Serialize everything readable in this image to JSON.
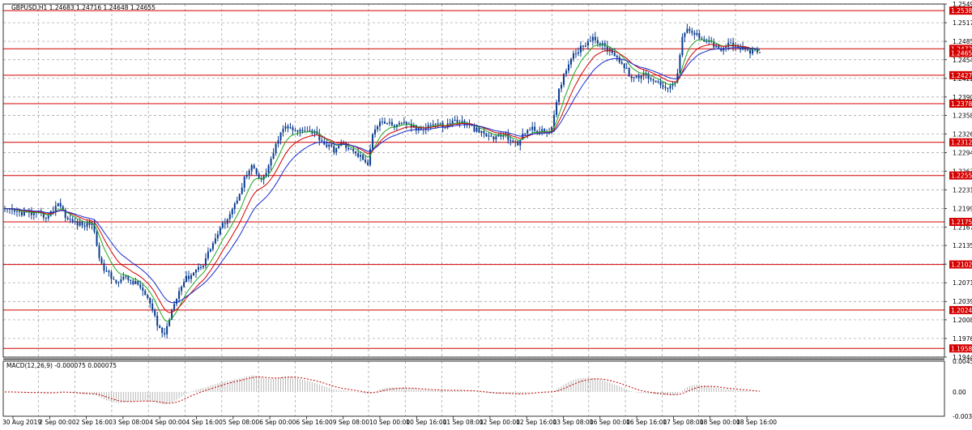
{
  "chart_data": {
    "type": "candlestick",
    "symbol_header": "GBPUSD,H1  1.24683 1.24716 1.24648 1.24655",
    "colors": {
      "candle": "#0a3c8f",
      "level_line": "#d40000",
      "level_tag": "#d40000",
      "current_tag": "#d40000",
      "ma_fast": "#1fa81f",
      "ma_mid": "#d40000",
      "ma_slow": "#1a2ccf",
      "grid": "#9a9a9a",
      "macd_hist": "#b8b8b8",
      "macd_signal": "#c00000"
    },
    "price_axis": {
      "ylim": [
        1.1944,
        1.25495
      ],
      "ticks": [
        "1.25495",
        "1.25175",
        "1.24855",
        "1.24540",
        "1.24220",
        "1.23900",
        "1.23585",
        "1.23265",
        "1.22945",
        "1.22630",
        "1.22310",
        "1.21990",
        "1.21670",
        "1.21355",
        "1.21035",
        "1.20715",
        "1.20395",
        "1.20080",
        "1.19760",
        "1.19440"
      ]
    },
    "levels": [
      "1.25382",
      "1.24727",
      "1.24275",
      "1.23787",
      "1.23124",
      "1.22555",
      "1.21759",
      "1.21029",
      "1.20247",
      "1.19589"
    ],
    "current_price": "1.24655",
    "x_labels": [
      "30 Aug 2019",
      "2 Sep 00:00",
      "2 Sep 16:00",
      "3 Sep 08:00",
      "4 Sep 00:00",
      "4 Sep 16:00",
      "5 Sep 08:00",
      "6 Sep 00:00",
      "6 Sep 16:00",
      "9 Sep 08:00",
      "10 Sep 00:00",
      "10 Sep 16:00",
      "11 Sep 08:00",
      "12 Sep 00:00",
      "12 Sep 16:00",
      "13 Sep 08:00",
      "16 Sep 00:00",
      "16 Sep 16:00",
      "17 Sep 08:00",
      "18 Sep 00:00",
      "18 Sep 16:00"
    ],
    "anchors": [
      [
        0,
        1.2195
      ],
      [
        10,
        1.219
      ],
      [
        18,
        1.2185
      ],
      [
        22,
        1.221
      ],
      [
        26,
        1.218
      ],
      [
        32,
        1.217
      ],
      [
        36,
        1.2175
      ],
      [
        40,
        1.21
      ],
      [
        45,
        1.2075
      ],
      [
        50,
        1.208
      ],
      [
        56,
        1.2065
      ],
      [
        60,
        1.2035
      ],
      [
        63,
        1.1998
      ],
      [
        66,
        1.1982
      ],
      [
        70,
        1.204
      ],
      [
        74,
        1.2075
      ],
      [
        78,
        1.209
      ],
      [
        82,
        1.2105
      ],
      [
        86,
        1.214
      ],
      [
        90,
        1.217
      ],
      [
        95,
        1.2205
      ],
      [
        99,
        1.225
      ],
      [
        102,
        1.227
      ],
      [
        106,
        1.2245
      ],
      [
        110,
        1.228
      ],
      [
        113,
        1.232
      ],
      [
        116,
        1.234
      ],
      [
        120,
        1.233
      ],
      [
        124,
        1.2335
      ],
      [
        128,
        1.233
      ],
      [
        132,
        1.231
      ],
      [
        136,
        1.23
      ],
      [
        140,
        1.231
      ],
      [
        144,
        1.2295
      ],
      [
        148,
        1.2285
      ],
      [
        150,
        1.227
      ],
      [
        152,
        1.233
      ],
      [
        155,
        1.235
      ],
      [
        158,
        1.2345
      ],
      [
        162,
        1.234
      ],
      [
        166,
        1.2345
      ],
      [
        170,
        1.2335
      ],
      [
        174,
        1.234
      ],
      [
        178,
        1.2345
      ],
      [
        182,
        1.234
      ],
      [
        186,
        1.235
      ],
      [
        190,
        1.2345
      ],
      [
        194,
        1.2335
      ],
      [
        198,
        1.2325
      ],
      [
        202,
        1.232
      ],
      [
        206,
        1.2325
      ],
      [
        210,
        1.2315
      ],
      [
        212,
        1.2305
      ],
      [
        214,
        1.233
      ],
      [
        218,
        1.2335
      ],
      [
        222,
        1.233
      ],
      [
        226,
        1.2335
      ],
      [
        229,
        1.24
      ],
      [
        232,
        1.244
      ],
      [
        235,
        1.2465
      ],
      [
        238,
        1.2475
      ],
      [
        242,
        1.249
      ],
      [
        245,
        1.2485
      ],
      [
        248,
        1.2475
      ],
      [
        252,
        1.2465
      ],
      [
        256,
        1.244
      ],
      [
        260,
        1.242
      ],
      [
        264,
        1.243
      ],
      [
        268,
        1.242
      ],
      [
        272,
        1.241
      ],
      [
        276,
        1.2408
      ],
      [
        278,
        1.243
      ],
      [
        280,
        1.249
      ],
      [
        282,
        1.2505
      ],
      [
        285,
        1.2498
      ],
      [
        288,
        1.2492
      ],
      [
        292,
        1.2484
      ],
      [
        295,
        1.247
      ],
      [
        298,
        1.2478
      ],
      [
        300,
        1.248
      ],
      [
        303,
        1.2475
      ],
      [
        306,
        1.247
      ],
      [
        310,
        1.2467
      ],
      [
        312,
        1.2466
      ]
    ],
    "macd": {
      "label": "MACD(12,26,9) -0.000075 0.000075",
      "ticks": [
        "0.004585",
        "0.00",
        "-0.00362"
      ],
      "ylim": [
        -0.00362,
        0.004585
      ]
    }
  }
}
